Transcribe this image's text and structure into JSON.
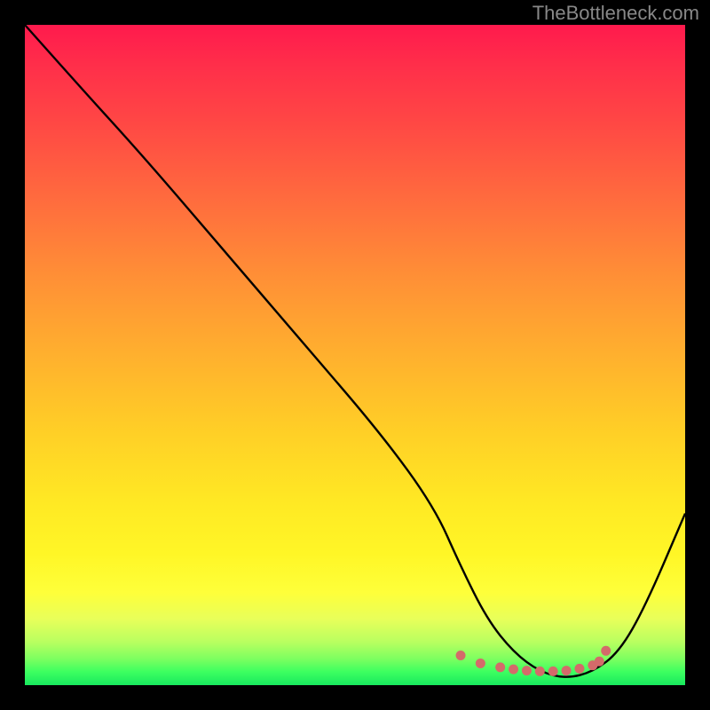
{
  "watermark": "TheBottleneck.com",
  "chart_data": {
    "type": "line",
    "title": "",
    "xlabel": "",
    "ylabel": "",
    "xlim": [
      0,
      100
    ],
    "ylim": [
      0,
      100
    ],
    "series": [
      {
        "name": "bottleneck-curve",
        "x": [
          0,
          8,
          18,
          30,
          42,
          54,
          62,
          66,
          70,
          74,
          78,
          82,
          86,
          90,
          94,
          100
        ],
        "y": [
          100,
          91,
          80,
          66,
          52,
          38,
          27,
          18,
          10,
          5,
          2,
          1,
          2,
          5,
          12,
          26
        ],
        "color": "#000000"
      },
      {
        "name": "optimal-range-markers",
        "x": [
          66,
          69,
          72,
          74,
          76,
          78,
          80,
          82,
          84,
          86,
          87,
          88
        ],
        "y": [
          4.5,
          3.3,
          2.7,
          2.4,
          2.2,
          2.1,
          2.1,
          2.2,
          2.5,
          3.0,
          3.6,
          5.2
        ],
        "color": "#d46a6a"
      }
    ],
    "annotations": []
  },
  "colors": {
    "background": "#000000",
    "curve": "#000000",
    "markers": "#d46a6a",
    "watermark": "#888888"
  }
}
